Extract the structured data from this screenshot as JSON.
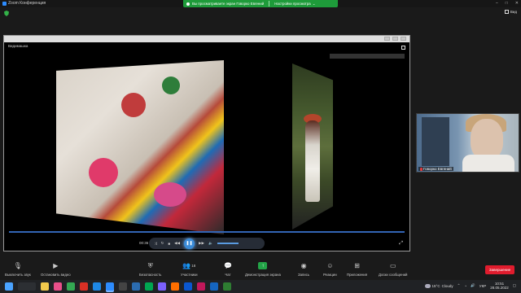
{
  "window": {
    "title": "Zoom Конференция"
  },
  "share_banner": {
    "text": "Вы просматриваете экран Говорко Евгений",
    "view_settings": "Настройки просмотра"
  },
  "view_button": {
    "label": "Вид"
  },
  "player": {
    "title": "Видимашка",
    "current_time": "00:36"
  },
  "participant": {
    "name": "Говорко Евгений"
  },
  "toolbar": {
    "mute": "Выключить звук",
    "stop_video": "Остановить видео",
    "security": "Безопасность",
    "participants": "Участники",
    "participants_count": "18",
    "chat": "Чат",
    "share": "Демонстрация экрана",
    "record": "Запись",
    "reactions": "Реакции",
    "apps": "Приложения",
    "whiteboard": "Доски сообщений",
    "end": "Завершение"
  },
  "taskbar": {
    "weather_temp": "15°C",
    "weather_cond": "Cloudy",
    "lang": "УКР",
    "time": "10:51",
    "date": "28.05.2022"
  },
  "colors": {
    "share_green": "#1e9b3a",
    "end_red": "#e01c2d",
    "accent_blue": "#3a8bd8"
  }
}
